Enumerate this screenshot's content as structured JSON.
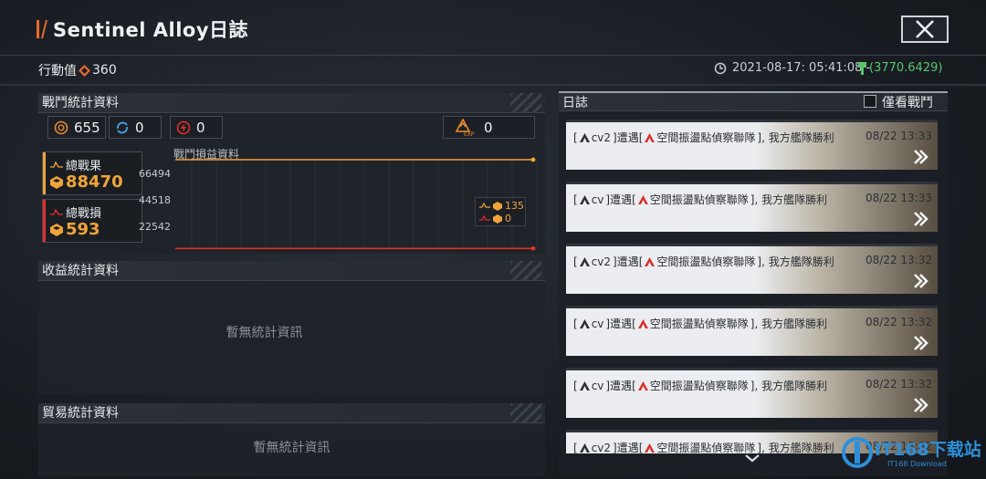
{
  "header": {
    "title": "Sentinel Alloy日誌",
    "action_points_label": "行動值",
    "action_points_value": "360",
    "datetime": "2021-08-17: 05:41:08 -",
    "money": "(3770.6429)"
  },
  "battle_stats": {
    "title": "戰鬥統計資料",
    "resources": [
      {
        "icon": "coin-icon",
        "value": "655"
      },
      {
        "icon": "cycle-icon",
        "value": "0"
      },
      {
        "icon": "lightning-icon",
        "value": "0"
      },
      {
        "icon": "exp-icon",
        "value": "0"
      }
    ],
    "total_gain_label": "總戰果",
    "total_gain_value": "88470",
    "total_loss_label": "總戰損",
    "total_loss_value": "593",
    "chart_title": "戰鬥損益資料",
    "legend_gain": "135",
    "legend_loss": "0"
  },
  "chart_data": {
    "type": "line",
    "title": "戰鬥損益資料",
    "y_ticks": [
      "66494",
      "44518",
      "22542"
    ],
    "series": [
      {
        "name": "總戰果",
        "color": "#f0a43a",
        "values": [
          88470,
          88470
        ]
      },
      {
        "name": "總戰損",
        "color": "#e0302c",
        "values": [
          593,
          593
        ]
      }
    ],
    "ylim": [
      0,
      88470
    ],
    "grid": true
  },
  "income_stats": {
    "title": "收益統計資料",
    "empty": "暫無統計資訊"
  },
  "trade_stats": {
    "title": "貿易統計資料",
    "empty": "暫無統計資訊"
  },
  "log": {
    "title": "日誌",
    "filter_label": "僅看戰鬥",
    "entries": [
      {
        "pre": "[",
        "ship": "cv2",
        "mid": "]遭遇[",
        "enemy": "空間振盪點偵察聯隊",
        "post": "], 我方艦隊勝利",
        "time": "08/22 13:33"
      },
      {
        "pre": "[",
        "ship": "cv",
        "mid": "]遭遇[",
        "enemy": "空間振盪點偵察聯隊",
        "post": "], 我方艦隊勝利",
        "time": "08/22 13:33"
      },
      {
        "pre": "[",
        "ship": "cv2",
        "mid": "]遭遇[",
        "enemy": "空間振盪點偵察聯隊",
        "post": "], 我方艦隊勝利",
        "time": "08/22 13:32"
      },
      {
        "pre": "[",
        "ship": "cv",
        "mid": "]遭遇[",
        "enemy": "空間振盪點偵察聯隊",
        "post": "], 我方艦隊勝利",
        "time": "08/22 13:32"
      },
      {
        "pre": "[",
        "ship": "cv",
        "mid": "]遭遇[",
        "enemy": "空間振盪點偵察聯隊",
        "post": "], 我方艦隊勝利",
        "time": "08/22 13:32"
      },
      {
        "pre": "[",
        "ship": "cv2",
        "mid": "]遭遇[",
        "enemy": "空間振盪點偵察聯隊",
        "post": "], 我方艦隊勝利",
        "time": "08/22 13:32"
      }
    ]
  },
  "watermark": {
    "brand": "IT168下载站",
    "sub": "IT168 Download"
  }
}
